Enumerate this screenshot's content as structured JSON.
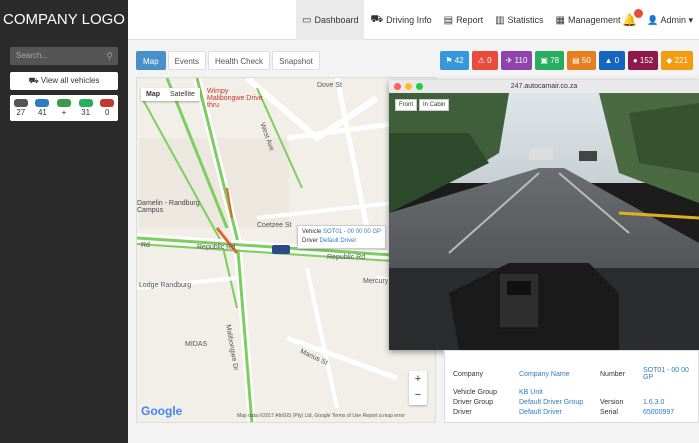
{
  "header": {
    "logo": "COMPANY LOGO",
    "nav": [
      {
        "label": "Dashboard",
        "icon": "monitor-icon"
      },
      {
        "label": "Driving Info",
        "icon": "car-icon"
      },
      {
        "label": "Report",
        "icon": "document-icon"
      },
      {
        "label": "Statistics",
        "icon": "bar-chart-icon"
      },
      {
        "label": "Management",
        "icon": "grid-icon"
      }
    ],
    "user": "Admin"
  },
  "sidebar": {
    "search_placeholder": "Search...",
    "view_all": "View all vehicles",
    "statuses": [
      {
        "value": "27",
        "color": "#555555"
      },
      {
        "value": "41",
        "color": "#2e7cc0"
      },
      {
        "value": "+",
        "color": "#3a9a4a"
      },
      {
        "value": "31",
        "color": "#27ae60"
      },
      {
        "value": "0",
        "color": "#c0392b"
      }
    ]
  },
  "tabs": [
    "Map",
    "Events",
    "Health Check",
    "Snapshot"
  ],
  "badges": [
    {
      "label": "42",
      "icon": "⚑",
      "color": "#3498db"
    },
    {
      "label": "0",
      "icon": "⚠",
      "color": "#e74c3c"
    },
    {
      "label": "110",
      "icon": "✈",
      "color": "#8e44ad"
    },
    {
      "label": "78",
      "icon": "▣",
      "color": "#27ae60"
    },
    {
      "label": "50",
      "icon": "▤",
      "color": "#e67e22"
    },
    {
      "label": "0",
      "icon": "▲",
      "color": "#1565c0"
    },
    {
      "label": "152",
      "icon": "●",
      "color": "#8e1a4a"
    },
    {
      "label": "221",
      "icon": "◆",
      "color": "#f39c12"
    }
  ],
  "map": {
    "toggle": [
      "Map",
      "Satellite"
    ],
    "labels": {
      "wimpy": "Wimpy Malibongwe Drive thru",
      "campus": "Damelin - Randburg Campus",
      "coetzee": "Coetzee St",
      "republic1": "Republic Rd",
      "republic2": "Republic Rd",
      "rd": "Rd",
      "lodge": "Lodge Randburg",
      "midas": "MIDAS",
      "mercury": "Mercury",
      "malibongwe": "Malibongwe Dr",
      "dove": "Dove St",
      "west": "West Ave",
      "marius": "Marius St"
    },
    "popup": {
      "vehicle_lbl": "Vehicle",
      "vehicle_val": "SOT01 - 00 00 00 GP",
      "driver_lbl": "Driver",
      "driver_val": "Default Driver"
    },
    "google": "Google",
    "attribution": "Map data ©2017 AfriGIS (Pty) Ltd, Google   Terms of Use   Report a map error"
  },
  "camera": {
    "url": "247.autocamair.co.za",
    "tabs": [
      "Front",
      "In Cabin"
    ]
  },
  "info": {
    "company_lbl": "Company",
    "company_val": "Company Name",
    "number_lbl": "Number",
    "number_val": "SOT01 - 00 00 GP",
    "vgroup_lbl": "Vehicle Group",
    "vgroup_val": "KB Unit",
    "dgroup_lbl": "Driver Group",
    "dgroup_val": "Default Driver Group",
    "version_lbl": "Version",
    "version_val": "1.6.3.0",
    "driver_lbl": "Driver",
    "driver_val": "Default Driver",
    "serial_lbl": "Serial",
    "serial_val": "65000997"
  }
}
